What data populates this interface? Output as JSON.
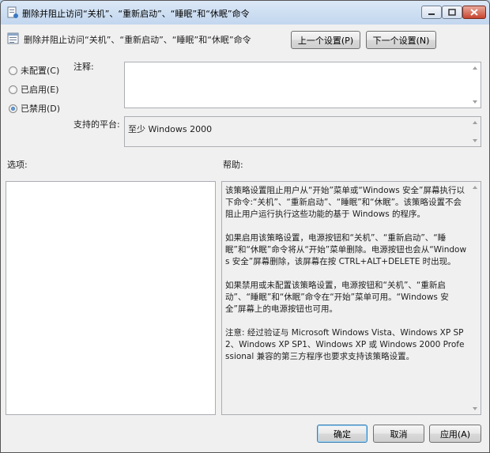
{
  "window": {
    "title": "删除并阻止访问“关机”、“重新启动”、“睡眠”和“休眠”命令"
  },
  "header": {
    "policy_title": "删除并阻止访问“关机”、“重新启动”、“睡眠”和“休眠”命令",
    "prev_button": "上一个设置(P)",
    "next_button": "下一个设置(N)"
  },
  "state_options": [
    {
      "label": "未配置(C)",
      "checked": false
    },
    {
      "label": "已启用(E)",
      "checked": false
    },
    {
      "label": "已禁用(D)",
      "checked": true
    }
  ],
  "comment": {
    "label": "注释:",
    "value": ""
  },
  "platform": {
    "label": "支持的平台:",
    "value": "至少 Windows 2000"
  },
  "options": {
    "label": "选项:"
  },
  "help": {
    "label": "帮助:",
    "paragraphs": [
      "该策略设置阻止用户从“开始”菜单或“Windows 安全”屏幕执行以下命令:“关机”、“重新启动”、“睡眠”和“休眠”。该策略设置不会阻止用户运行执行这些功能的基于 Windows 的程序。",
      "如果启用该策略设置，电源按钮和“关机”、“重新启动”、“睡眠”和“休眠”命令将从“开始”菜单删除。电源按钮也会从“Windows 安全”屏幕删除，该屏幕在按 CTRL+ALT+DELETE 时出现。",
      "如果禁用或未配置该策略设置，电源按钮和“关机”、“重新启动”、“睡眠”和“休眠”命令在“开始”菜单可用。“Windows 安全”屏幕上的电源按钮也可用。",
      "注意: 经过验证与 Microsoft Windows Vista、Windows XP SP2、Windows XP SP1、Windows XP 或 Windows 2000 Professional 兼容的第三方程序也要求支持该策略设置。"
    ]
  },
  "footer": {
    "ok": "确定",
    "cancel": "取消",
    "apply": "应用(A)"
  }
}
